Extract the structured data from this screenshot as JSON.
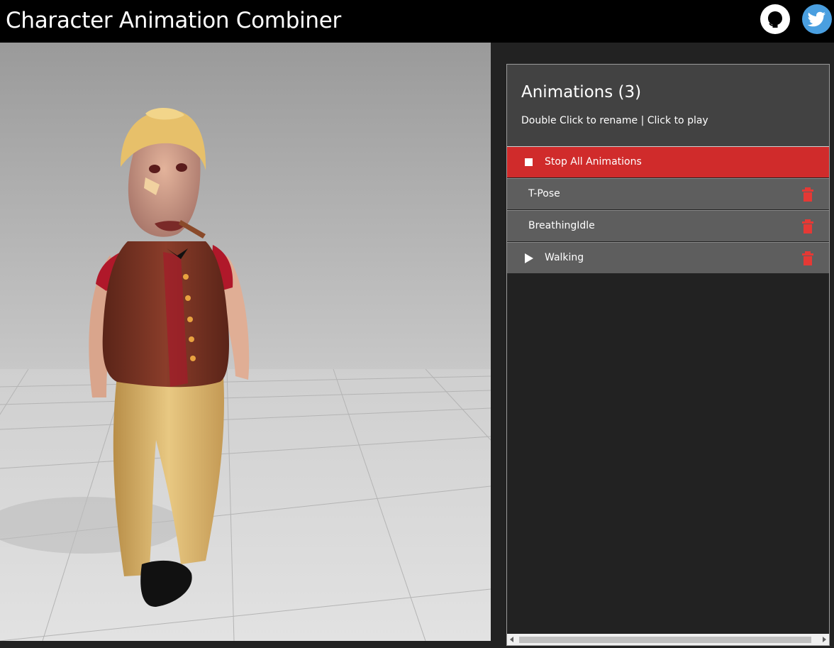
{
  "app": {
    "title": "Character Animation Combiner"
  },
  "header_links": [
    {
      "icon": "github-icon"
    },
    {
      "icon": "twitter-icon"
    }
  ],
  "panel": {
    "title": "Animations (3)",
    "hint": "Double Click to rename | Click to play",
    "stop_label": "Stop All Animations",
    "animations": [
      {
        "name": "T-Pose",
        "playing": false
      },
      {
        "name": "BreathingIdle",
        "playing": false
      },
      {
        "name": "Walking",
        "playing": true
      }
    ]
  },
  "colors": {
    "topbar": "#000000",
    "stop_row": "#d02b2b",
    "row": "#5e5e5e",
    "panel_header": "#424242",
    "trash": "#e53935",
    "twitter": "#4a9fe0"
  }
}
